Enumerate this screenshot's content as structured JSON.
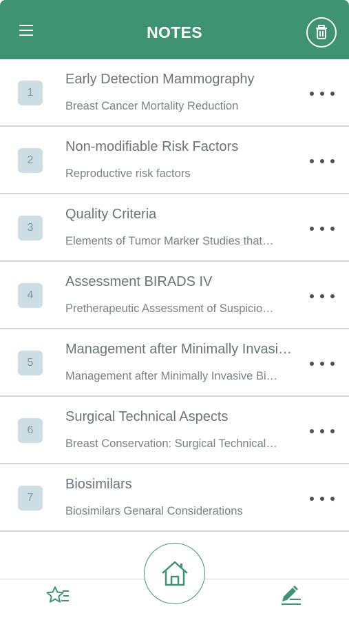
{
  "header": {
    "title": "NOTES"
  },
  "icons": {
    "menu": "hamburger-menu-icon",
    "trash": "trash-icon",
    "more": "more-horizontal-icon",
    "home": "home-icon",
    "favorites": "star-list-icon",
    "edit": "pen-edit-icon"
  },
  "colors": {
    "header": "#3e9373",
    "badge": "#cddde4"
  },
  "notes": [
    {
      "number": "1",
      "title": "Early Detection Mammography",
      "subtitle": "Breast Cancer Mortality Reduction"
    },
    {
      "number": "2",
      "title": "Non-modifiable Risk Factors",
      "subtitle": "Reproductive risk factors"
    },
    {
      "number": "3",
      "title": "Quality Criteria",
      "subtitle": "Elements of Tumor Marker Studies that…"
    },
    {
      "number": "4",
      "title": "Assessment BIRADS IV",
      "subtitle": "Pretherapeutic Assessment of Suspicio…"
    },
    {
      "number": "5",
      "title": "Management after Minimally Invasi…",
      "subtitle": "Management after Minimally Invasive Bi…"
    },
    {
      "number": "6",
      "title": "Surgical Technical Aspects",
      "subtitle": "Breast Conservation: Surgical Technical…"
    },
    {
      "number": "7",
      "title": "Biosimilars",
      "subtitle": "Biosimilars Genaral Considerations"
    }
  ]
}
